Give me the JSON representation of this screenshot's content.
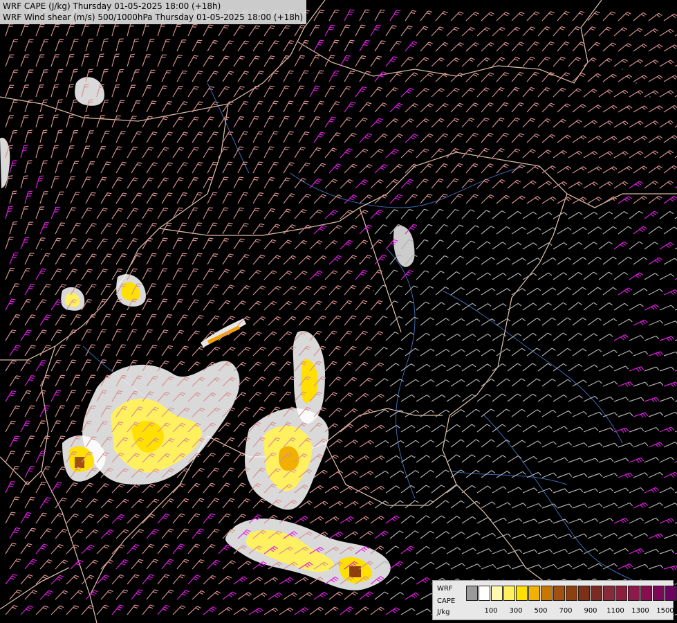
{
  "titles": {
    "line1": "WRF CAPE (J/kg) Thursday 01-05-2025 18:00 (+18h)",
    "line2": "WRF Wind shear (m/s) 500/1000hPa Thursday 01-05-2025 18:00 (+18h)"
  },
  "legend": {
    "model": "WRF",
    "variable": "CAPE",
    "unit": "J/kg",
    "colors": [
      "#ffffff",
      "#fff8b0",
      "#fff060",
      "#ffe000",
      "#f2b000",
      "#c87800",
      "#a05010",
      "#8c4010",
      "#7c3018",
      "#7a2a20",
      "#8a2a38",
      "#8a2040",
      "#8c1a4a",
      "#880e50",
      "#7c0858",
      "#6a0460",
      "#54005a"
    ],
    "tick_labels": [
      "100",
      "300",
      "500",
      "700",
      "900",
      "1100",
      "1300",
      "1500"
    ]
  },
  "colors": {
    "background": "#000000",
    "barb_pink": "#d89090",
    "barb_gray": "#b0b0b0",
    "barb_magenta": "#e020e0",
    "border_tan": "#d8b8a0",
    "river_blue": "#3c6ab0",
    "cape_yellow": "#ffe000",
    "cape_orange": "#f2a000"
  }
}
